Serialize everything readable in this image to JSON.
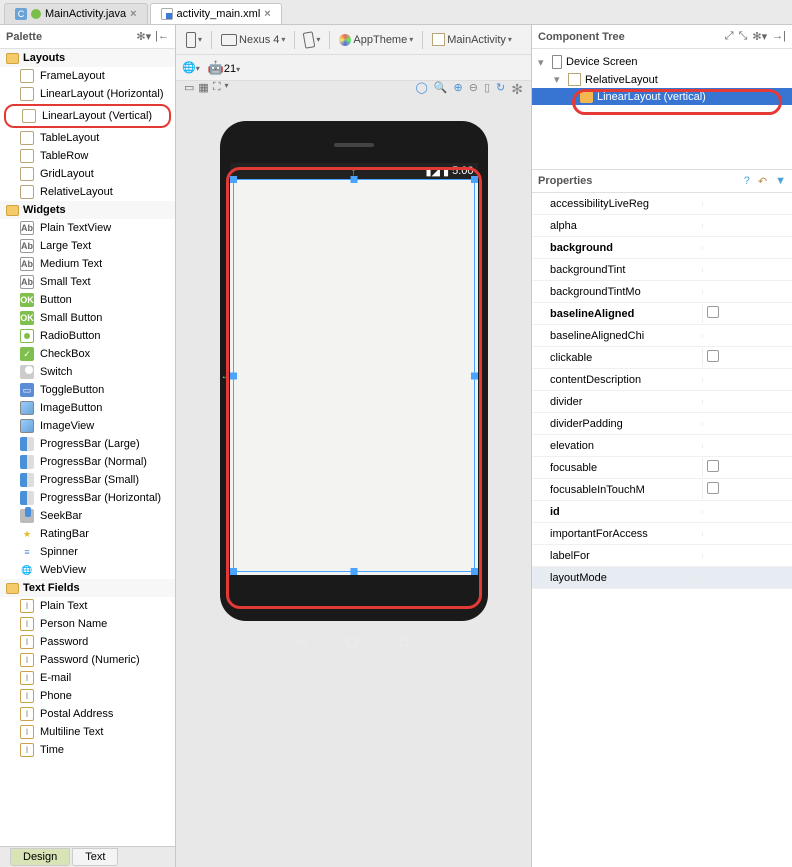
{
  "tabs": {
    "file1": "MainActivity.java",
    "file2": "activity_main.xml"
  },
  "palette": {
    "title": "Palette",
    "groups": {
      "layouts": {
        "title": "Layouts",
        "items": [
          "FrameLayout",
          "LinearLayout (Horizontal)",
          "LinearLayout (Vertical)",
          "TableLayout",
          "TableRow",
          "GridLayout",
          "RelativeLayout"
        ]
      },
      "widgets": {
        "title": "Widgets",
        "items": [
          "Plain TextView",
          "Large Text",
          "Medium Text",
          "Small Text",
          "Button",
          "Small Button",
          "RadioButton",
          "CheckBox",
          "Switch",
          "ToggleButton",
          "ImageButton",
          "ImageView",
          "ProgressBar (Large)",
          "ProgressBar (Normal)",
          "ProgressBar (Small)",
          "ProgressBar (Horizontal)",
          "SeekBar",
          "RatingBar",
          "Spinner",
          "WebView"
        ]
      },
      "textfields": {
        "title": "Text Fields",
        "items": [
          "Plain Text",
          "Person Name",
          "Password",
          "Password (Numeric)",
          "E-mail",
          "Phone",
          "Postal Address",
          "Multiline Text",
          "Time"
        ]
      }
    }
  },
  "designer": {
    "device": "Nexus 4",
    "theme": "AppTheme",
    "activity": "MainActivity",
    "api": "21",
    "time": "5:00"
  },
  "tree": {
    "title": "Component Tree",
    "root": "Device Screen",
    "child1": "RelativeLayout",
    "child2": "LinearLayout (vertical)"
  },
  "properties": {
    "title": "Properties",
    "items": [
      {
        "name": "accessibilityLiveReg",
        "type": "text"
      },
      {
        "name": "alpha",
        "type": "text"
      },
      {
        "name": "background",
        "type": "text",
        "bold": true
      },
      {
        "name": "backgroundTint",
        "type": "text"
      },
      {
        "name": "backgroundTintMo",
        "type": "text"
      },
      {
        "name": "baselineAligned",
        "type": "check",
        "bold": true
      },
      {
        "name": "baselineAlignedChi",
        "type": "text"
      },
      {
        "name": "clickable",
        "type": "check"
      },
      {
        "name": "contentDescription",
        "type": "text"
      },
      {
        "name": "divider",
        "type": "text"
      },
      {
        "name": "dividerPadding",
        "type": "text"
      },
      {
        "name": "elevation",
        "type": "text"
      },
      {
        "name": "focusable",
        "type": "check"
      },
      {
        "name": "focusableInTouchM",
        "type": "check"
      },
      {
        "name": "id",
        "type": "text",
        "bold": true
      },
      {
        "name": "importantForAccess",
        "type": "text"
      },
      {
        "name": "labelFor",
        "type": "text"
      },
      {
        "name": "layoutMode",
        "type": "text",
        "sel": true
      }
    ]
  },
  "bottomtabs": {
    "design": "Design",
    "text": "Text"
  }
}
